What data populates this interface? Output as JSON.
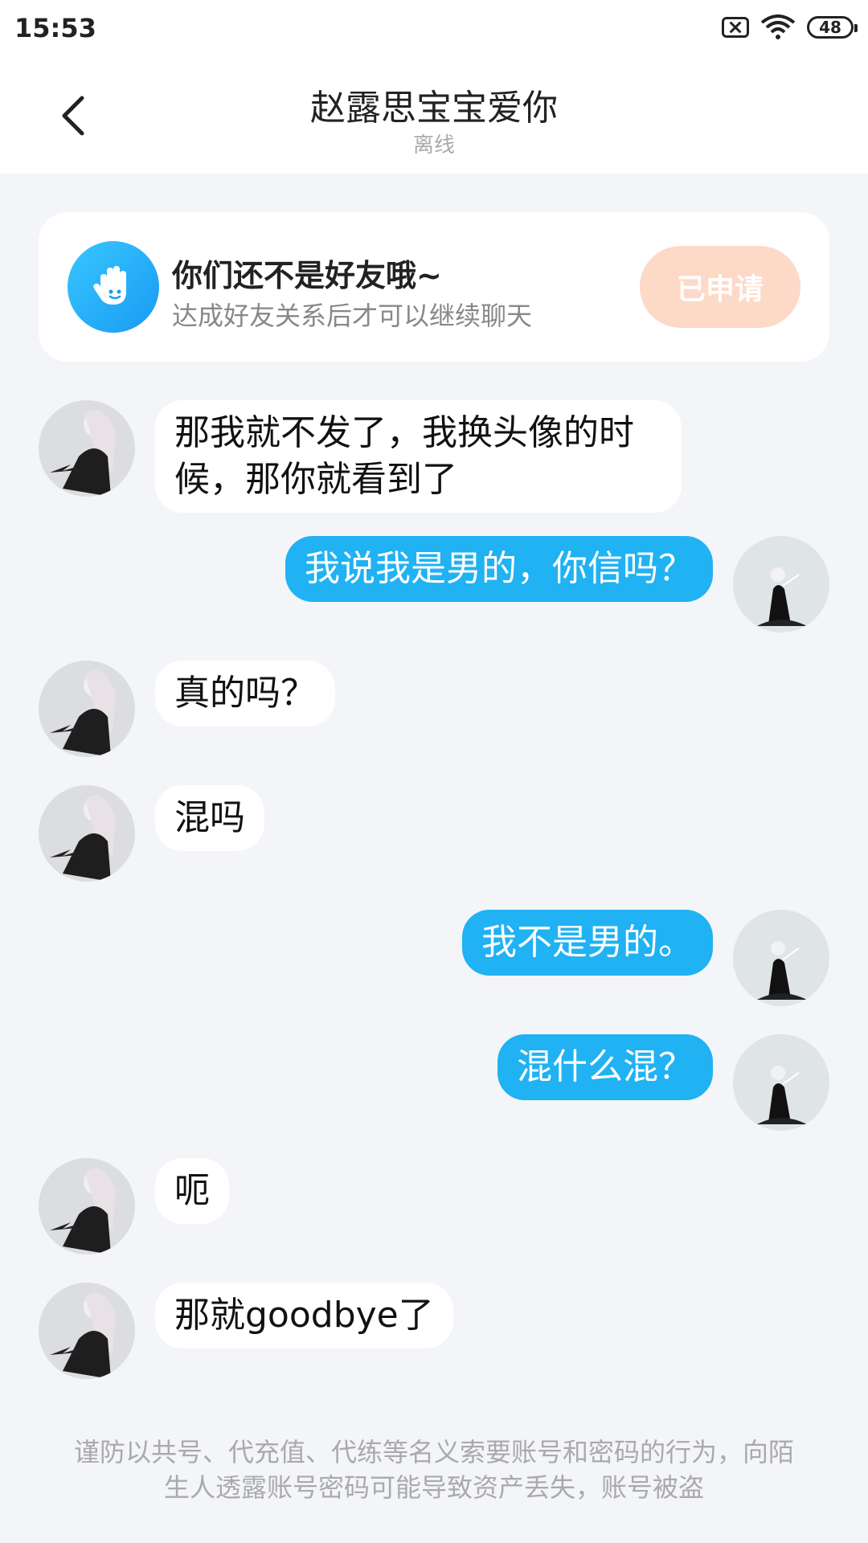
{
  "status_bar": {
    "time": "15:53",
    "battery": "48"
  },
  "header": {
    "title": "赵露思宝宝爱你",
    "status": "离线"
  },
  "friend_notice": {
    "title": "你们还不是好友哦~",
    "subtitle": "达成好友关系后才可以继续聊天",
    "button_label": "已申请"
  },
  "messages": [
    {
      "side": "left",
      "text": "那我就不发了，我换头像的时候，那你就看到了"
    },
    {
      "side": "right",
      "text": "我说我是男的，你信吗？"
    },
    {
      "side": "left",
      "text": "真的吗？"
    },
    {
      "side": "left",
      "text": "混吗"
    },
    {
      "side": "right",
      "text": "我不是男的。"
    },
    {
      "side": "right",
      "text": "混什么混？"
    },
    {
      "side": "left",
      "text": "呃"
    },
    {
      "side": "left",
      "text": "那就goodbye了"
    }
  ],
  "footer_warning": "谨防以共号、代充值、代练等名义索要账号和密码的行为，向陌生人透露账号密码可能导致资产丢失，账号被盗",
  "colors": {
    "accent": "#20b2f2",
    "applied_button": "#fdd9c8",
    "background": "#f3f5f8"
  }
}
